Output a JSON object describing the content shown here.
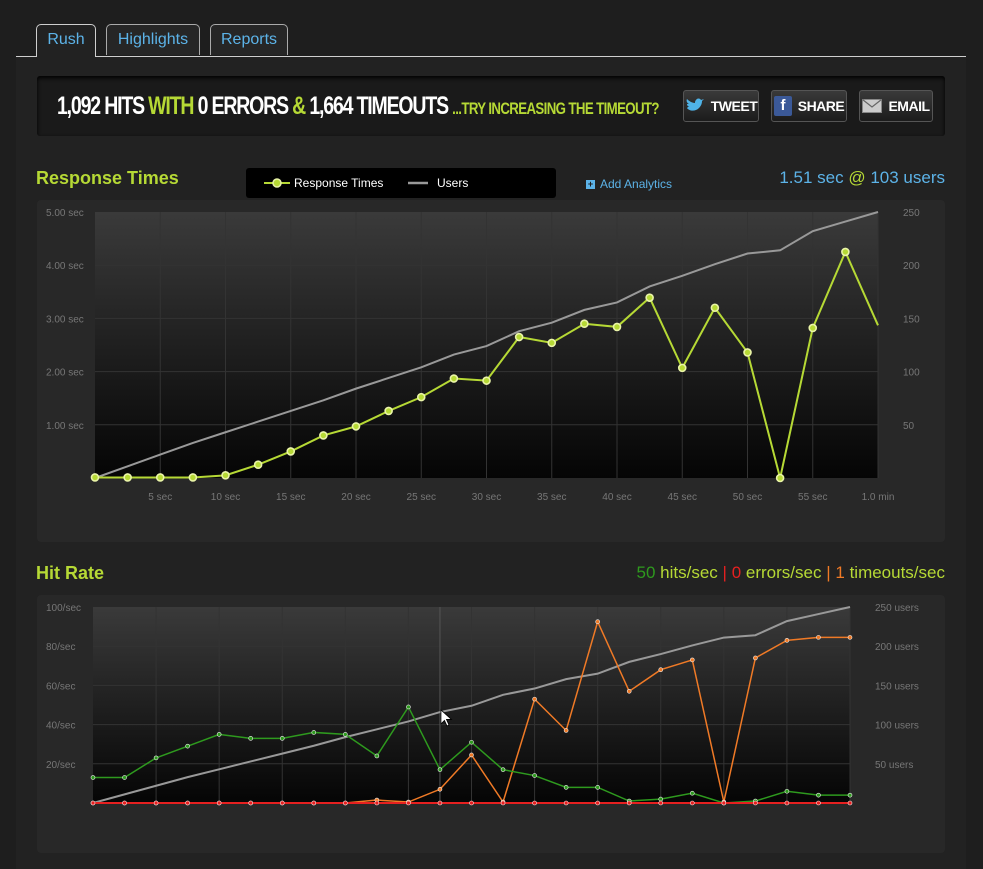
{
  "tabs": [
    {
      "label": "Rush"
    },
    {
      "label": "Highlights"
    },
    {
      "label": "Reports"
    }
  ],
  "banner": {
    "hits": "1,092 HITS",
    "with": "WITH",
    "errors": "0 ERRORS",
    "amp": "&",
    "timeouts": "1,664 TIMEOUTS",
    "hint": "...TRY INCREASING THE TIMEOUT?"
  },
  "buttons": {
    "tweet": "TWEET",
    "share": "SHARE",
    "email": "EMAIL"
  },
  "response": {
    "title": "Response Times",
    "legend_response": "Response Times",
    "legend_users": "Users",
    "add_analytics": "Add Analytics",
    "stat_value": "1.51 sec",
    "stat_at": "@",
    "stat_users": "103 users"
  },
  "hitrate": {
    "title": "Hit Rate",
    "hits_value": "50",
    "hits_label": "hits/sec",
    "sep": "|",
    "errors_value": "0",
    "errors_label": "errors/sec",
    "timeouts_value": "1",
    "timeouts_label": "timeouts/sec"
  },
  "colors": {
    "accent": "#b6d935",
    "link": "#5cb3e8",
    "hits": "#2e9a1e",
    "errors": "#e62020",
    "timeouts": "#f07a26",
    "users": "#999999"
  },
  "chart_data": [
    {
      "type": "line",
      "name": "response-times",
      "x_ticks": [
        "5 sec",
        "10 sec",
        "15 sec",
        "20 sec",
        "25 sec",
        "30 sec",
        "35 sec",
        "40 sec",
        "45 sec",
        "50 sec",
        "55 sec",
        "1.0 min"
      ],
      "y_ticks": [
        "5.00 sec",
        "4.00 sec",
        "3.00 sec",
        "2.00 sec",
        "1.00 sec"
      ],
      "y2_ticks": [
        "250",
        "200",
        "150",
        "100",
        "50"
      ],
      "xlim": [
        0,
        60
      ],
      "ylim": [
        0,
        5
      ],
      "y2lim": [
        0,
        250
      ],
      "series": [
        {
          "name": "Response Times",
          "axis": "left",
          "markers": true,
          "x": [
            0,
            2.5,
            5,
            7.5,
            10,
            12.5,
            15,
            17.5,
            20,
            22.5,
            25,
            27.5,
            30,
            32.5,
            35,
            37.5,
            40,
            42.5,
            45,
            47.5,
            50,
            52.5,
            55,
            57.5,
            60
          ],
          "y": [
            0.01,
            0.01,
            0.01,
            0.01,
            0.05,
            0.25,
            0.5,
            0.8,
            0.97,
            1.26,
            1.52,
            1.87,
            1.83,
            2.65,
            2.54,
            2.9,
            2.84,
            3.39,
            2.07,
            3.2,
            2.36,
            0.0,
            2.82,
            4.25,
            2.87
          ],
          "marker_count": 24
        },
        {
          "name": "Users",
          "axis": "right",
          "markers": false,
          "x": [
            0,
            2.5,
            5,
            7.5,
            10,
            12.5,
            15,
            17.5,
            20,
            22.5,
            25,
            27.5,
            30,
            32.5,
            35,
            37.5,
            40,
            42.5,
            45,
            47.5,
            50,
            52.5,
            55,
            57.5,
            60
          ],
          "y": [
            0,
            11,
            22,
            33,
            43,
            53,
            63,
            73,
            84,
            94,
            104,
            116,
            124,
            138,
            146,
            158,
            165,
            180,
            190,
            201,
            211,
            214,
            232,
            241,
            250
          ]
        }
      ],
      "grid": true
    },
    {
      "type": "line",
      "name": "hit-rate",
      "y_ticks": [
        "100/sec",
        "80/sec",
        "60/sec",
        "40/sec",
        "20/sec"
      ],
      "y2_ticks": [
        "250 users",
        "200 users",
        "150 users",
        "100 users",
        "50 users"
      ],
      "xlim": [
        0,
        60
      ],
      "ylim": [
        0,
        100
      ],
      "y2lim": [
        0,
        250
      ],
      "series": [
        {
          "name": "hits/sec",
          "color": "hits",
          "x": [
            0,
            2.5,
            5,
            7.5,
            10,
            12.5,
            15,
            17.5,
            20,
            22.5,
            25,
            27.5,
            30,
            32.5,
            35,
            37.5,
            40,
            42.5,
            45,
            47.5,
            50,
            52.5,
            55,
            57.5,
            60
          ],
          "y": [
            13,
            13,
            23,
            29,
            35,
            33,
            33,
            36,
            35,
            24,
            49,
            17,
            31,
            17,
            14,
            8,
            8,
            1,
            2,
            5,
            0,
            1,
            6,
            4,
            4
          ]
        },
        {
          "name": "errors/sec",
          "color": "errors",
          "x": [
            0,
            2.5,
            5,
            7.5,
            10,
            12.5,
            15,
            17.5,
            20,
            22.5,
            25,
            27.5,
            30,
            32.5,
            35,
            37.5,
            40,
            42.5,
            45,
            47.5,
            50,
            52.5,
            55,
            57.5,
            60
          ],
          "y": [
            0,
            0,
            0,
            0,
            0,
            0,
            0,
            0,
            0,
            0,
            0,
            0,
            0,
            0,
            0,
            0,
            0,
            0,
            0,
            0,
            0,
            0,
            0,
            0,
            0
          ]
        },
        {
          "name": "timeouts/sec",
          "color": "timeouts",
          "x": [
            0,
            2.5,
            5,
            7.5,
            10,
            12.5,
            15,
            17.5,
            20,
            22.5,
            25,
            27.5,
            30,
            32.5,
            35,
            37.5,
            40,
            42.5,
            45,
            47.5,
            50,
            52.5,
            55,
            57.5,
            60
          ],
          "y": [
            0,
            0,
            0,
            0,
            0,
            0,
            0,
            0,
            0,
            1.5,
            0.5,
            7,
            24.5,
            0.5,
            53,
            37,
            92.5,
            57,
            68,
            73,
            0.5,
            74,
            83,
            84.5,
            84.5
          ]
        },
        {
          "name": "users",
          "color": "users",
          "axis": "right",
          "x": [
            0,
            2.5,
            5,
            7.5,
            10,
            12.5,
            15,
            17.5,
            20,
            22.5,
            25,
            27.5,
            30,
            32.5,
            35,
            37.5,
            40,
            42.5,
            45,
            47.5,
            50,
            52.5,
            55,
            57.5,
            60
          ],
          "y": [
            0,
            11,
            22,
            33,
            43,
            53,
            63,
            73,
            84,
            94,
            104,
            116,
            124,
            138,
            146,
            158,
            165,
            180,
            190,
            201,
            211,
            214,
            232,
            241,
            250
          ]
        }
      ],
      "grid": true
    }
  ]
}
